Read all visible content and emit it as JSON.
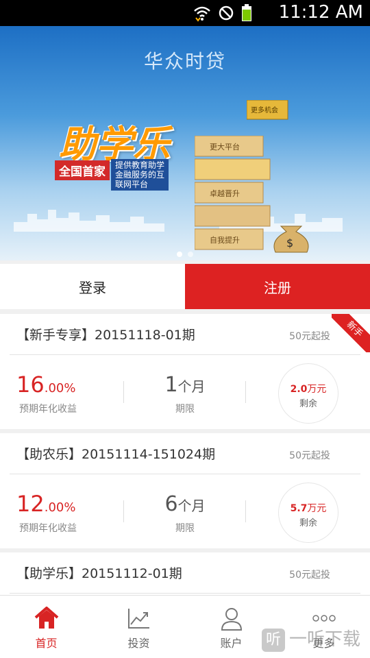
{
  "status_bar": {
    "time": "11:12 AM"
  },
  "banner": {
    "brand": "华众时贷",
    "title": "助学乐",
    "tag_primary": "全国首家",
    "tag_secondary": "提供教育助学 金融服务的互联网平台",
    "blocks": [
      "更大平台",
      "卓越晋升",
      "自我提升",
      "更多机会"
    ],
    "page_count": 2,
    "active_page": 1
  },
  "auth": {
    "login_label": "登录",
    "register_label": "注册"
  },
  "products": [
    {
      "name": "【新手专享】20151118-01期",
      "min_invest": "50元起投",
      "ribbon": "新手",
      "rate_int": "16",
      "rate_dec": ".00%",
      "rate_label": "预期年化收益",
      "term_num": "1",
      "term_unit": "个月",
      "term_label": "期限",
      "remaining_amount": "2.0",
      "remaining_unit": "万元",
      "remaining_label": "剩余"
    },
    {
      "name": "【助农乐】20151114-151024期",
      "min_invest": "50元起投",
      "rate_int": "12",
      "rate_dec": ".00%",
      "rate_label": "预期年化收益",
      "term_num": "6",
      "term_unit": "个月",
      "term_label": "期限",
      "remaining_amount": "5.7",
      "remaining_unit": "万元",
      "remaining_label": "剩余"
    },
    {
      "name": "【助学乐】20151112-01期",
      "min_invest": "50元起投"
    }
  ],
  "tabs": [
    {
      "label": "首页",
      "icon": "home-icon",
      "active": true
    },
    {
      "label": "投资",
      "icon": "chart-trend-icon"
    },
    {
      "label": "账户",
      "icon": "user-icon"
    },
    {
      "label": "更多",
      "icon": "more-icon"
    }
  ],
  "watermark": {
    "glyph": "听",
    "text": "一听下载"
  },
  "colors": {
    "accent": "#dd2222",
    "rate": "#d82424"
  }
}
